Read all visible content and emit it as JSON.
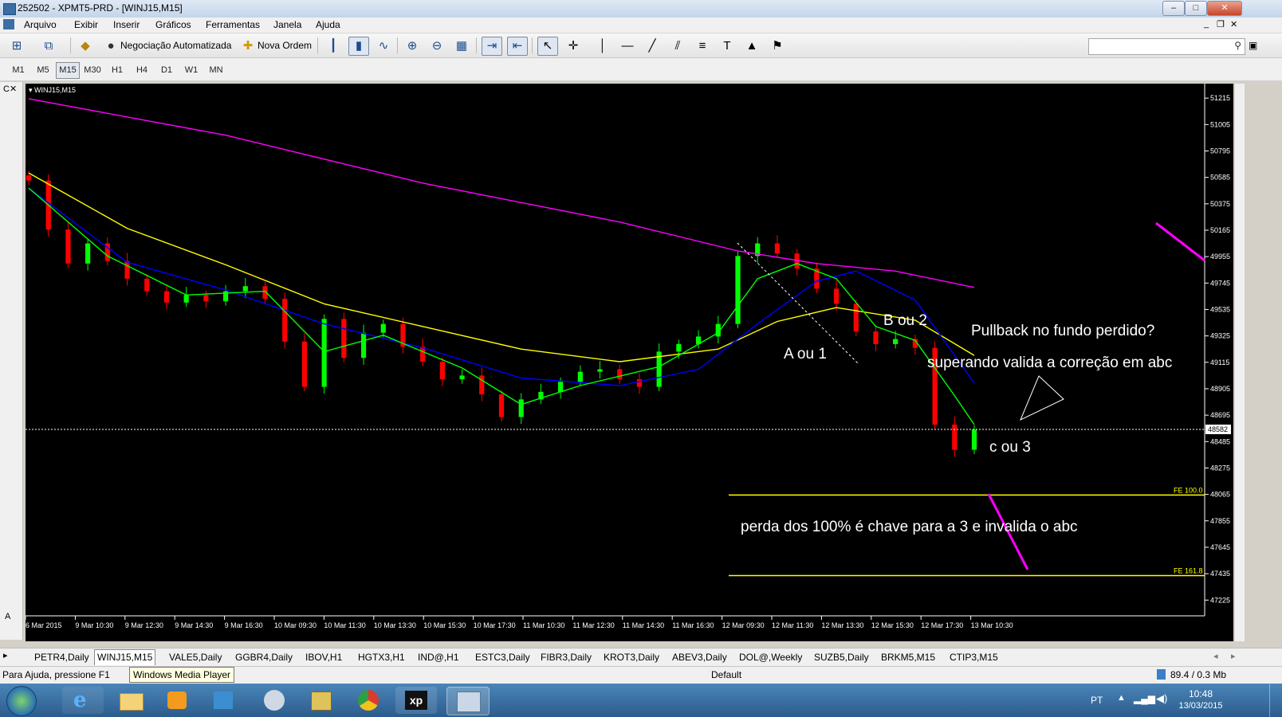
{
  "window": {
    "title": "252502 - XPMT5-PRD - [WINJ15,M15]"
  },
  "menu": [
    "Arquivo",
    "Exibir",
    "Inserir",
    "Gráficos",
    "Ferramentas",
    "Janela",
    "Ajuda"
  ],
  "toolbar": {
    "auto_trading": "Negociação Automatizada",
    "new_order": "Nova Ordem"
  },
  "timeframes": {
    "items": [
      "M1",
      "M5",
      "M15",
      "M30",
      "H1",
      "H4",
      "D1",
      "W1",
      "MN"
    ],
    "active": "M15"
  },
  "chart_data": {
    "type": "candlestick",
    "symbol_label": "WINJ15,M15",
    "ylim": [
      47100,
      51330
    ],
    "y_ticks": [
      51215,
      51005,
      50795,
      50585,
      50375,
      50165,
      49955,
      49745,
      49535,
      49325,
      49115,
      48905,
      48695,
      48485,
      48275,
      48065,
      47855,
      47645,
      47435,
      47225
    ],
    "x_ticks": [
      "6 Mar 2015",
      "9 Mar 10:30",
      "9 Mar 12:30",
      "9 Mar 14:30",
      "9 Mar 16:30",
      "10 Mar 09:30",
      "10 Mar 11:30",
      "10 Mar 13:30",
      "10 Mar 15:30",
      "10 Mar 17:30",
      "11 Mar 10:30",
      "11 Mar 12:30",
      "11 Mar 14:30",
      "11 Mar 16:30",
      "12 Mar 09:30",
      "12 Mar 11:30",
      "12 Mar 13:30",
      "12 Mar 15:30",
      "12 Mar 17:30",
      "13 Mar 10:30"
    ],
    "close_trace": [
      [
        0,
        50560
      ],
      [
        1,
        50170
      ],
      [
        2,
        49900
      ],
      [
        3,
        50060
      ],
      [
        4,
        49920
      ],
      [
        5,
        49780
      ],
      [
        6,
        49680
      ],
      [
        7,
        49590
      ],
      [
        8,
        49650
      ],
      [
        9,
        49600
      ],
      [
        10,
        49680
      ],
      [
        11,
        49720
      ],
      [
        12,
        49620
      ],
      [
        13,
        49280
      ],
      [
        14,
        48920
      ],
      [
        15,
        49460
      ],
      [
        16,
        49150
      ],
      [
        17,
        49350
      ],
      [
        18,
        49420
      ],
      [
        19,
        49240
      ],
      [
        20,
        49120
      ],
      [
        21,
        48980
      ],
      [
        22,
        49010
      ],
      [
        23,
        48860
      ],
      [
        24,
        48680
      ],
      [
        25,
        48820
      ],
      [
        26,
        48880
      ],
      [
        27,
        48960
      ],
      [
        28,
        49040
      ],
      [
        29,
        49060
      ],
      [
        30,
        48980
      ],
      [
        31,
        48920
      ],
      [
        32,
        49200
      ],
      [
        33,
        49260
      ],
      [
        34,
        49320
      ],
      [
        35,
        49420
      ],
      [
        36,
        49960
      ],
      [
        37,
        50060
      ],
      [
        38,
        49980
      ],
      [
        39,
        49860
      ],
      [
        40,
        49700
      ],
      [
        41,
        49580
      ],
      [
        42,
        49360
      ],
      [
        43,
        49260
      ],
      [
        44,
        49300
      ],
      [
        45,
        49230
      ],
      [
        46,
        48620
      ],
      [
        47,
        48420
      ],
      [
        48,
        48580
      ]
    ],
    "indicators": [
      {
        "color": "#ff00ff",
        "points": [
          [
            0,
            51210
          ],
          [
            10,
            50920
          ],
          [
            20,
            50540
          ],
          [
            30,
            50230
          ],
          [
            36,
            50000
          ],
          [
            40,
            49900
          ],
          [
            44,
            49840
          ],
          [
            48,
            49710
          ]
        ]
      },
      {
        "color": "#ffff00",
        "points": [
          [
            0,
            50620
          ],
          [
            5,
            50180
          ],
          [
            10,
            49890
          ],
          [
            15,
            49580
          ],
          [
            20,
            49400
          ],
          [
            25,
            49220
          ],
          [
            30,
            49120
          ],
          [
            35,
            49220
          ],
          [
            38,
            49440
          ],
          [
            41,
            49550
          ],
          [
            45,
            49450
          ],
          [
            48,
            49170
          ]
        ]
      },
      {
        "color": "#0000ff",
        "points": [
          [
            0,
            50500
          ],
          [
            5,
            49910
          ],
          [
            10,
            49690
          ],
          [
            15,
            49420
          ],
          [
            20,
            49230
          ],
          [
            25,
            48990
          ],
          [
            30,
            48930
          ],
          [
            34,
            49060
          ],
          [
            37,
            49420
          ],
          [
            40,
            49760
          ],
          [
            42,
            49840
          ],
          [
            45,
            49610
          ],
          [
            48,
            48950
          ]
        ]
      },
      {
        "color": "#00ff00",
        "points": [
          [
            0,
            50500
          ],
          [
            4,
            49960
          ],
          [
            8,
            49650
          ],
          [
            12,
            49680
          ],
          [
            15,
            49200
          ],
          [
            18,
            49330
          ],
          [
            22,
            49070
          ],
          [
            25,
            48780
          ],
          [
            28,
            48930
          ],
          [
            32,
            49080
          ],
          [
            35,
            49350
          ],
          [
            37,
            49780
          ],
          [
            39,
            49900
          ],
          [
            41,
            49780
          ],
          [
            43,
            49400
          ],
          [
            45,
            49290
          ],
          [
            47,
            48850
          ],
          [
            48,
            48620
          ]
        ]
      }
    ],
    "price_line": {
      "value": 48582,
      "label": "48582"
    },
    "fib_lines": [
      {
        "label": "FE 100.0",
        "value": 48060,
        "color": "#ffff00"
      },
      {
        "label": "FE 161.8",
        "value": 47420,
        "color": "#ffff00"
      }
    ],
    "annotations": [
      "A ou 1",
      "B ou 2",
      "Pullback no fundo perdido?",
      "superando valida a correção em abc",
      "c ou 3",
      "perda dos 100%  é chave para a 3 e invalida o abc"
    ]
  },
  "tabs": [
    "PETR4,Daily",
    "WINJ15,M15",
    "VALE5,Daily",
    "GGBR4,Daily",
    "IBOV,H1",
    "HGTX3,H1",
    "IND@,H1",
    "ESTC3,Daily",
    "FIBR3,Daily",
    "KROT3,Daily",
    "ABEV3,Daily",
    "DOL@,Weekly",
    "SUZB5,Daily",
    "BRKM5,M15",
    "CTIP3,M15"
  ],
  "active_tab": "WINJ15,M15",
  "status": {
    "help": "Para Ajuda, pressione F1",
    "tooltip": "Windows Media Player",
    "profile": "Default",
    "traffic": "89.4 / 0.3 Mb"
  },
  "taskbar": {
    "lang": "PT",
    "time": "10:48",
    "date": "13/03/2015"
  }
}
